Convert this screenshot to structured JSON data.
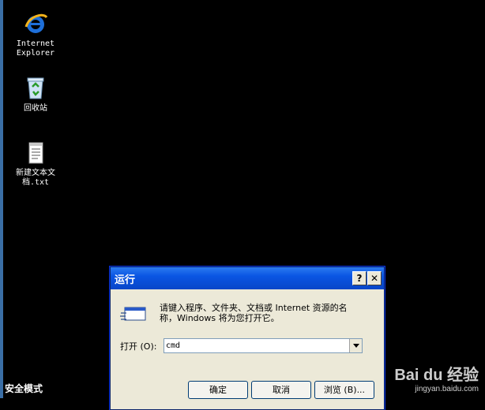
{
  "desktop": {
    "icons": [
      {
        "label_line1": "Internet",
        "label_line2": "Explorer"
      },
      {
        "label_line1": "回收站",
        "label_line2": ""
      },
      {
        "label_line1": "新建文本文",
        "label_line2": "档.txt"
      }
    ],
    "safe_mode": "安全模式"
  },
  "run_dialog": {
    "title": "运行",
    "help": "?",
    "close": "✕",
    "prompt_line1": "请键入程序、文件夹、文档或 Internet 资源的名",
    "prompt_line2": "称，Windows 将为您打开它。",
    "open_label": "打开 (O):",
    "open_value": "cmd",
    "ok_label": "确定",
    "cancel_label": "取消",
    "browse_label": "浏览 (B)..."
  },
  "watermark": {
    "main": "Bai du 经验",
    "sub": "jingyan.baidu.com"
  },
  "colors": {
    "desktop_bg": "#000000",
    "titlebar": "#0a55e3",
    "dialog_bg": "#ece9d8"
  }
}
